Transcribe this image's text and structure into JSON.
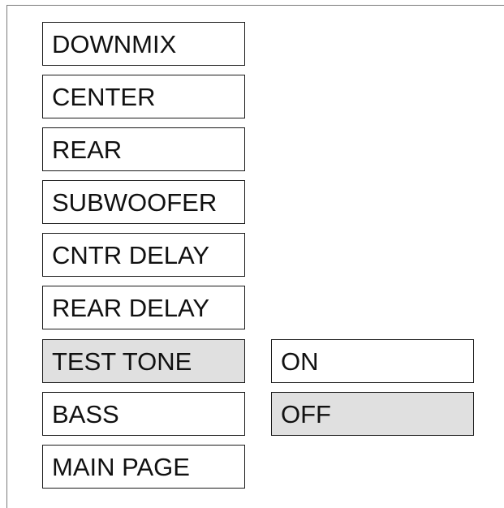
{
  "menu": {
    "items": [
      {
        "label": "DOWNMIX",
        "selected": false
      },
      {
        "label": "CENTER",
        "selected": false
      },
      {
        "label": "REAR",
        "selected": false
      },
      {
        "label": "SUBWOOFER",
        "selected": false
      },
      {
        "label": "CNTR DELAY",
        "selected": false
      },
      {
        "label": "REAR DELAY",
        "selected": false
      },
      {
        "label": "TEST TONE",
        "selected": true
      },
      {
        "label": "BASS",
        "selected": false
      },
      {
        "label": "MAIN PAGE",
        "selected": false
      }
    ]
  },
  "submenu": {
    "options": [
      {
        "label": "ON",
        "selected": false
      },
      {
        "label": "OFF",
        "selected": true
      }
    ]
  },
  "colors": {
    "selected_background": "#e0e0e0",
    "border": "#1a1a1a",
    "background": "#ffffff"
  }
}
